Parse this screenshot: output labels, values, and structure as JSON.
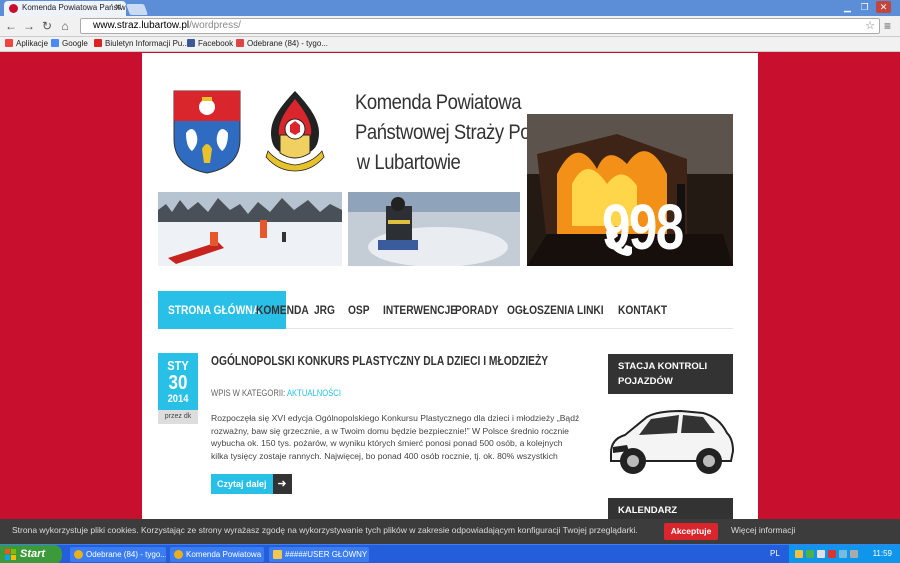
{
  "browser": {
    "tab_title": "Komenda Powiatowa Państw",
    "url_host": "www.straz.lubartow.pl",
    "url_path": "/wordpress/",
    "bookmarks": [
      {
        "label": "Aplikacje",
        "icon": "apps-grid-icon",
        "color": "#e44"
      },
      {
        "label": "Google",
        "icon": "google-icon",
        "color": "#4a8af4"
      },
      {
        "label": "Biuletyn Informacji Pu...",
        "icon": "bip-icon",
        "color": "#d22"
      },
      {
        "label": "Facebook",
        "icon": "facebook-icon",
        "color": "#3b5998"
      },
      {
        "label": "Odebrane (84) - tygo...",
        "icon": "gmail-icon",
        "color": "#d44"
      }
    ]
  },
  "header": {
    "title_lines": [
      "Komenda Powiatowa",
      "Państwowej Straży Pożarnej",
      "w Lubartowie"
    ],
    "phone_number": "998"
  },
  "nav": {
    "items": [
      "STRONA GŁÓWNA",
      "KOMENDA",
      "JRG",
      "OSP",
      "INTERWENCJE",
      "PORADY",
      "OGŁOSZENIA",
      "LINKI",
      "KONTAKT"
    ]
  },
  "post": {
    "date_month": "STY",
    "date_day": "30",
    "date_year": "2014",
    "date_ago": "przez dk",
    "title": "OGÓLNOPOLSKI KONKURS PLASTYCZNY DLA DZIECI I MŁODZIEŻY",
    "meta_prefix": "WPIS W KATEGORII:",
    "category": "AKTUALNOŚCI",
    "excerpt": "Rozpoczęła się XVI edycja Ogólnopolskiego Konkursu Plastycznego dla dzieci i młodzieży „Bądź rozważny, baw się grzecznie, a w Twoim domu będzie bezpiecznie!” W Polsce średnio rocznie wybucha ok. 150 tys. pożarów, w wyniku których śmierć ponosi ponad 500 osób, a kolejnych kilka tysięcy zostaje rannych. Najwięcej, bo ponad 400 osób rocznie, tj. ok. 80% wszystkich",
    "read_more": "Czytaj dalej"
  },
  "sidebar": {
    "widget1_title": "STACJA KONTROLI POJAZDÓW",
    "widget2_title": "KALENDARZ"
  },
  "cookie": {
    "text": "Strona wykorzystuje pliki cookies. Korzystając ze strony wyrażasz zgodę na wykorzystywanie tych plików w zakresie odpowiadającym konfiguracji Twojej przeglądarki.",
    "accept": "Akceptuje",
    "more": "Więcej informacji"
  },
  "taskbar": {
    "start": "Start",
    "tasks": [
      "Odebrane (84) - tygo...",
      "Komenda Powiatowa ...",
      "#####USER GŁÓWNY"
    ],
    "lang": "PL",
    "clock": "11:59"
  },
  "colors": {
    "accent": "#29c0e8",
    "brand_red": "#c8102e",
    "dark": "#333333"
  }
}
